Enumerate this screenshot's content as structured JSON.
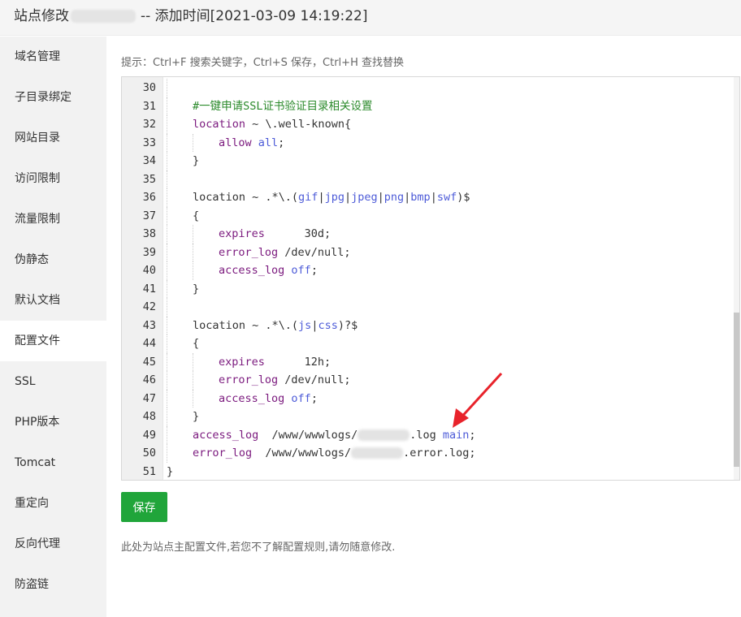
{
  "title": {
    "prefix": "站点修改",
    "suffix": "-- 添加时间[2021-03-09 14:19:22]"
  },
  "sidebar": {
    "items": [
      {
        "label": "域名管理"
      },
      {
        "label": "子目录绑定"
      },
      {
        "label": "网站目录"
      },
      {
        "label": "访问限制"
      },
      {
        "label": "流量限制"
      },
      {
        "label": "伪静态"
      },
      {
        "label": "默认文档"
      },
      {
        "label": "配置文件",
        "active": true
      },
      {
        "label": "SSL"
      },
      {
        "label": "PHP版本"
      },
      {
        "label": "Tomcat"
      },
      {
        "label": "重定向"
      },
      {
        "label": "反向代理"
      },
      {
        "label": "防盗链"
      }
    ]
  },
  "hint": "提示：Ctrl+F 搜索关键字，Ctrl+S 保存，Ctrl+H 查找替换",
  "editor": {
    "lines": [
      {
        "num": "30",
        "indent": 1,
        "segs": []
      },
      {
        "num": "31",
        "indent": 1,
        "segs": [
          {
            "t": "#一键申请SSL证书验证目录相关设置",
            "c": "cmt"
          }
        ]
      },
      {
        "num": "32",
        "indent": 1,
        "segs": [
          {
            "t": "location",
            "c": "kw"
          },
          {
            "t": " ~ \\.well-known{",
            "c": ""
          }
        ]
      },
      {
        "num": "33",
        "indent": 2,
        "segs": [
          {
            "t": "allow",
            "c": "kw"
          },
          {
            "t": " ",
            "c": ""
          },
          {
            "t": "all",
            "c": "val"
          },
          {
            "t": ";",
            "c": ""
          }
        ]
      },
      {
        "num": "34",
        "indent": 1,
        "segs": [
          {
            "t": "}",
            "c": ""
          }
        ]
      },
      {
        "num": "35",
        "indent": 1,
        "segs": []
      },
      {
        "num": "36",
        "indent": 1,
        "segs": [
          {
            "t": "location ~ .*\\.(",
            "c": ""
          },
          {
            "t": "gif",
            "c": "val"
          },
          {
            "t": "|",
            "c": ""
          },
          {
            "t": "jpg",
            "c": "val"
          },
          {
            "t": "|",
            "c": ""
          },
          {
            "t": "jpeg",
            "c": "val"
          },
          {
            "t": "|",
            "c": ""
          },
          {
            "t": "png",
            "c": "val"
          },
          {
            "t": "|",
            "c": ""
          },
          {
            "t": "bmp",
            "c": "val"
          },
          {
            "t": "|",
            "c": ""
          },
          {
            "t": "swf",
            "c": "val"
          },
          {
            "t": ")$",
            "c": ""
          }
        ]
      },
      {
        "num": "37",
        "indent": 1,
        "segs": [
          {
            "t": "{",
            "c": ""
          }
        ]
      },
      {
        "num": "38",
        "indent": 2,
        "segs": [
          {
            "t": "expires",
            "c": "kw"
          },
          {
            "t": "      30d;",
            "c": ""
          }
        ]
      },
      {
        "num": "39",
        "indent": 2,
        "segs": [
          {
            "t": "error_log",
            "c": "kw"
          },
          {
            "t": " /dev/null;",
            "c": ""
          }
        ]
      },
      {
        "num": "40",
        "indent": 2,
        "segs": [
          {
            "t": "access_log",
            "c": "kw"
          },
          {
            "t": " ",
            "c": ""
          },
          {
            "t": "off",
            "c": "val"
          },
          {
            "t": ";",
            "c": ""
          }
        ]
      },
      {
        "num": "41",
        "indent": 1,
        "segs": [
          {
            "t": "}",
            "c": ""
          }
        ]
      },
      {
        "num": "42",
        "indent": 1,
        "segs": []
      },
      {
        "num": "43",
        "indent": 1,
        "segs": [
          {
            "t": "location ~ .*\\.(",
            "c": ""
          },
          {
            "t": "js",
            "c": "val"
          },
          {
            "t": "|",
            "c": ""
          },
          {
            "t": "css",
            "c": "val"
          },
          {
            "t": ")?$",
            "c": ""
          }
        ]
      },
      {
        "num": "44",
        "indent": 1,
        "segs": [
          {
            "t": "{",
            "c": ""
          }
        ]
      },
      {
        "num": "45",
        "indent": 2,
        "segs": [
          {
            "t": "expires",
            "c": "kw"
          },
          {
            "t": "      12h;",
            "c": ""
          }
        ]
      },
      {
        "num": "46",
        "indent": 2,
        "segs": [
          {
            "t": "error_log",
            "c": "kw"
          },
          {
            "t": " /dev/null;",
            "c": ""
          }
        ]
      },
      {
        "num": "47",
        "indent": 2,
        "segs": [
          {
            "t": "access_log",
            "c": "kw"
          },
          {
            "t": " ",
            "c": ""
          },
          {
            "t": "off",
            "c": "val"
          },
          {
            "t": ";",
            "c": ""
          }
        ]
      },
      {
        "num": "48",
        "indent": 1,
        "segs": [
          {
            "t": "}",
            "c": ""
          }
        ]
      },
      {
        "num": "49",
        "indent": 1,
        "segs": [
          {
            "t": "access_log",
            "c": "kw"
          },
          {
            "t": "  /www/wwwlogs/",
            "c": ""
          },
          {
            "t": "",
            "c": "mask"
          },
          {
            "t": ".log ",
            "c": ""
          },
          {
            "t": "main",
            "c": "val"
          },
          {
            "t": ";",
            "c": ""
          }
        ]
      },
      {
        "num": "50",
        "indent": 1,
        "segs": [
          {
            "t": "error_log",
            "c": "kw"
          },
          {
            "t": "  /www/wwwlogs/",
            "c": ""
          },
          {
            "t": "",
            "c": "mask"
          },
          {
            "t": ".error.log;",
            "c": ""
          }
        ]
      },
      {
        "num": "51",
        "indent": 0,
        "segs": [
          {
            "t": "}",
            "c": ""
          }
        ]
      }
    ]
  },
  "save_label": "保存",
  "footnote": "此处为站点主配置文件,若您不了解配置规则,请勿随意修改.",
  "colors": {
    "accent": "#20a53a",
    "arrow": "#e8232b"
  }
}
